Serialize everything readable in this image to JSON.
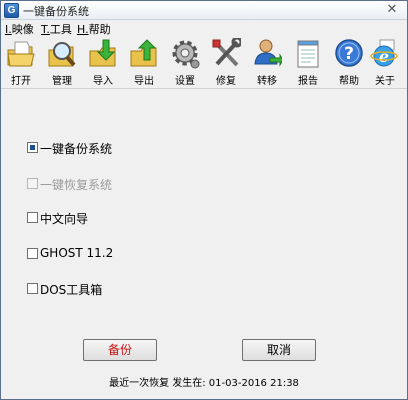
{
  "window": {
    "title": "一键备份系统",
    "app_icon": "G",
    "close": "✕"
  },
  "menu": [
    {
      "key": "I.",
      "label": "映像"
    },
    {
      "key": "T.",
      "label": "工具"
    },
    {
      "key": "H.",
      "label": "帮助"
    }
  ],
  "toolbar": [
    {
      "icon": "open-folder-icon",
      "label": "打开"
    },
    {
      "icon": "manage-magnifier-icon",
      "label": "管理"
    },
    {
      "icon": "import-folder-icon",
      "label": "导入"
    },
    {
      "icon": "export-folder-icon",
      "label": "导出"
    },
    {
      "icon": "gear-icon",
      "label": "设置"
    },
    {
      "icon": "tools-icon",
      "label": "修复"
    },
    {
      "icon": "user-transfer-icon",
      "label": "转移"
    },
    {
      "icon": "report-notepad-icon",
      "label": "报告"
    },
    {
      "icon": "help-icon",
      "label": "帮助"
    },
    {
      "icon": "about-ie-icon",
      "label": "关于"
    }
  ],
  "options": [
    {
      "label": "一键备份系统",
      "checked": true,
      "enabled": true
    },
    {
      "label": "一键恢复系统",
      "checked": false,
      "enabled": false
    },
    {
      "label": "中文向导",
      "checked": false,
      "enabled": true
    },
    {
      "label": "GHOST 11.2",
      "checked": false,
      "enabled": true
    },
    {
      "label": "DOS工具箱",
      "checked": false,
      "enabled": true
    }
  ],
  "buttons": {
    "backup": "备份",
    "cancel": "取消"
  },
  "status": {
    "text": "最近一次恢复 发生在: 01-03-2016  21:38"
  },
  "colors": {
    "accent": "#1c4f8f",
    "primary_button_text": "#c81414"
  }
}
